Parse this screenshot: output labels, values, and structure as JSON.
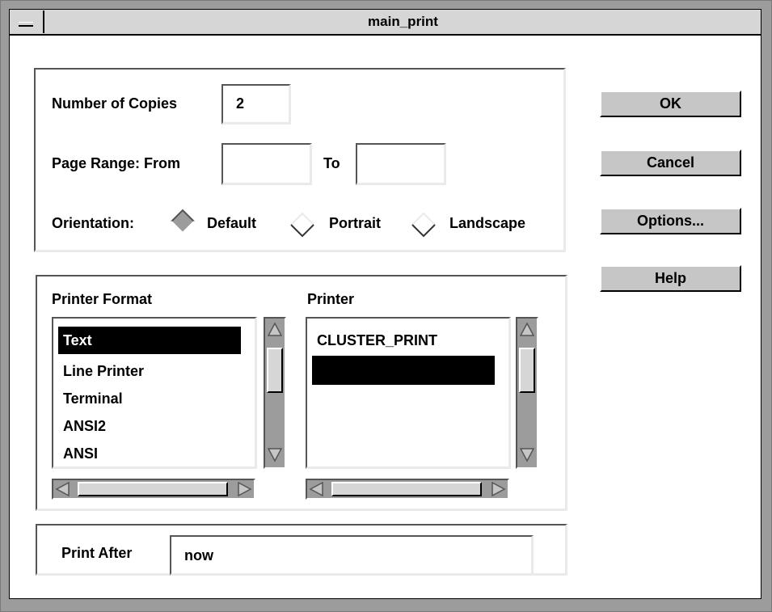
{
  "window": {
    "title": "main_print"
  },
  "copies": {
    "label": "Number of Copies",
    "value": "2"
  },
  "page_range": {
    "from_label": "Page Range: From",
    "from_value": "",
    "to_label": "To",
    "to_value": ""
  },
  "orientation": {
    "label": "Orientation:",
    "options": [
      "Default",
      "Portrait",
      "Landscape"
    ],
    "selected": "Default"
  },
  "printer_format": {
    "label": "Printer Format",
    "items": [
      "Text",
      "Line Printer",
      "Terminal",
      "ANSI2",
      "ANSI"
    ],
    "selected": "Text"
  },
  "printer": {
    "label": "Printer",
    "items": [
      "CLUSTER_PRINT",
      ""
    ],
    "selected_index": 1
  },
  "print_after": {
    "label": "Print After",
    "value": "now"
  },
  "buttons": {
    "ok": "OK",
    "cancel": "Cancel",
    "options": "Options...",
    "help": "Help"
  },
  "colors": {
    "frame": "#9c9c9c",
    "title_bg": "#d6d6d6",
    "button_bg": "#c6c6c6",
    "selection": "#000000"
  }
}
